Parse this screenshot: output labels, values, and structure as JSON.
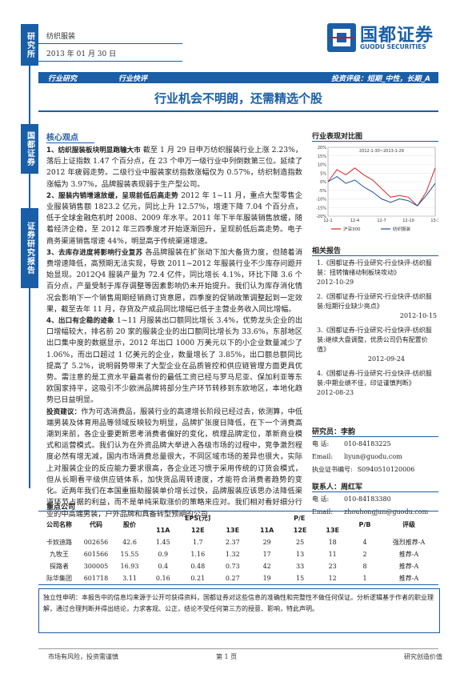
{
  "side": {
    "top_label": "研究所",
    "mid_label": "国都证券",
    "bottom_label": "证券研究报告"
  },
  "header": {
    "category": "纺织服装",
    "date": "2013 年 01 月 30 日",
    "logo_cn": "国都证券",
    "logo_en": "GUODU SECURITIES",
    "left_tag": "行业研究",
    "mid_tag": "行业快评",
    "rating": "投资评级：短期_中性，长期_A"
  },
  "title": "行业机会不明朗，还需精选个股",
  "core_view_title": "核心观点",
  "paragraphs": [
    {
      "bold": "1、纺织服装板块明显跑输大市",
      "text": "截至 1 月 29 日申万纺织服装行业上涨 2.23%，落后上证指数 1.47 个百分点，在 23 个申万一级行业中列倒数第三位。延续了 2012 年疲弱走势。二级行业中服装家纺指数涨幅仅为 0.57%，纺织制造指数涨幅为 3.97%，品牌服装表现弱于生产型公司。"
    },
    {
      "bold": "2、服装内销增速放缓，呈现前低后高走势",
      "text": "2012 年 1~11 月，重点大型零售企业服装销售额 1823.2 亿元，同比上升 12.57%，增速下降 7.04 个百分点，低于全球金融危机时 2008、2009 年水平。2011 年下半年服装销售放缓，随着经济企稳，至 2012 年三四季度才开始逐渐回升，呈现前低后高走势。电子商务渠道销售增速 44%，明显高于传统渠道增速。"
    },
    {
      "bold": "3、去库存进度将影响行业复苏",
      "text": "各品牌服装在扩张动下加大备货力度，但随着消费增速降低，高预期无法实现，导致 2011~2012 年服装行业不少库存问题开始显现。2012Q4 服装产量为 72.4 亿件，同比增长 4.1%，环比下降 3.6 个百分点，产量受制于库存调整等因素影响仍未开始提升。我们认为库存消化情况会影响下一个销售周期经销商订货意愿，四季度的促销政策调整起到一定效果，截至去年 11 月，存货及产成品同比增幅已低于主营业务收入同比增幅。"
    },
    {
      "bold": "4、出口有企稳的迹象",
      "text": "1~11 月服装出口额同比增长 3.4%，优势龙头企业的出口增幅较大，排名前 20 家的服装企业的出口额同比增长为 33.6%，东部地区出口集中度的数据显示，2012 年出口 1000 万美元以下的小企业数量减少了 1.06%，而出口超过 1 亿美元的企业，数量增长了 3.85%，出口额总额同比提高了 5.2%，说明弱势带来了大型企业在品质管控和供应链管理方面更具优势。需注意的是工资水平最高者份的最低工资已经与罗马尼亚、保加利亚等东欧国家持平，这吸引不少欧洲品牌将部分生产环节转移到东欧地区，本地化趋势已日益明显。"
    },
    {
      "bold": "投资建议：",
      "text": "作为可选消费品，服装行业的高速增长阶段已经过去，依测算，中低端男装及体育用品等领域反映较为明显，品牌扩张度日降低，在下一个消费高潮到来前，各企业要更新思考消费者偏好的变化，梳理品牌定位，革新商业模式和运营模式。我们认为在外资品牌大举进入各级市场的过程中，竞争激烈程度必然有增无减，国内市场消费总量很大，不同区域市场的差异也很大，实际上对服装企业的反应能力要求很高，各企业还习惯于采用传统的订货会模式，但从长期看平级供应链体系，加快货品周转速度，才能符合消费者趋势的变化。近两年我们在本国重振助服装单价增长过快，品牌服装应该思办法降低渠道环节占据的利益，而不是单纯采取涨价的策略来应对。我们相对看好细分行业的中高端男装，户外品牌和具备转型预期的公司。"
    }
  ],
  "chart": {
    "section_title": "行业表现对比图",
    "period": "2012-1-30~2013-1-29",
    "legend": [
      "沪深300",
      "纺织服装"
    ],
    "xticks": [
      "12-1",
      "12-4",
      "12-7",
      "12-10",
      "13-1"
    ],
    "yticks": [
      "20%",
      "15%",
      "10%",
      "5%",
      "0%",
      "-5%",
      "-10%",
      "-15%",
      "-20%"
    ]
  },
  "chart_data": {
    "type": "line",
    "x": [
      "12-1",
      "12-2",
      "12-3",
      "12-4",
      "12-5",
      "12-6",
      "12-7",
      "12-8",
      "12-9",
      "12-10",
      "12-11",
      "12-12",
      "13-1"
    ],
    "series": [
      {
        "name": "沪深300",
        "values": [
          0,
          7,
          4,
          8,
          4,
          1,
          -4,
          -9,
          -8,
          -9,
          -14,
          -6,
          8
        ]
      },
      {
        "name": "纺织服装",
        "values": [
          0,
          3,
          -1,
          1,
          -3,
          -6,
          -10,
          -12,
          -10,
          -11,
          -14,
          -8,
          -1
        ]
      }
    ],
    "ylim": [
      -20,
      20
    ],
    "xlabel": "",
    "ylabel": ""
  },
  "related": {
    "section_title": "相关报告",
    "items": [
      {
        "text": "1.《国都证券-行业研究-行业快评-纺织服装：扭转情绪动制板块攻动》",
        "date": "2012-10-29"
      },
      {
        "text": "2.《国都证券-行业研究-行业快评-纺织服装:短期行业缺少亮点》",
        "date": "2012-10-15"
      },
      {
        "text": "3.《国都证券-行业研究-行业快评-纺织服装:继续大盘调整，优质公司仍有配置价值》",
        "date": "2012-09-24"
      },
      {
        "text": "4.《国都证券-行业研究-行业快评-纺织服装:中期业绩不佳，印证谨慎判断》",
        "date": "2012-08-23"
      }
    ]
  },
  "analyst": {
    "title": "研究员：李韵",
    "phone_label": "电  话:",
    "phone": "010-84183225",
    "email_label": "Email:",
    "email": "liyun@guodu.com",
    "cert_label": "执业证书编号:",
    "cert": "S0940510120006"
  },
  "contact": {
    "title": "联系人：周红军",
    "phone_label": "电  话:",
    "phone": "010-84183380",
    "email_label": "Email:",
    "email": "zhouhongjun@guodu.com"
  },
  "table": {
    "title": "重点公司",
    "h_name": "公司名称",
    "h_code": "代码",
    "h_price": "股价",
    "h_eps": "EPS(元)",
    "h_pe": "P/E",
    "h_pb": "P/B",
    "h_rating": "评级",
    "years": [
      "11A",
      "12E",
      "13E",
      "11A",
      "12E",
      "13E"
    ],
    "rows": [
      {
        "name": "卡奴迪路",
        "code": "002656",
        "price": "42.6",
        "eps": [
          "1.45",
          "1.7",
          "2.37"
        ],
        "pe": [
          "29",
          "25",
          "18"
        ],
        "pb": "4",
        "rating": "强烈推荐-A"
      },
      {
        "name": "九牧王",
        "code": "601566",
        "price": "15.55",
        "eps": [
          "0.9",
          "1.16",
          "1.32"
        ],
        "pe": [
          "17",
          "13",
          "11"
        ],
        "pb": "2",
        "rating": "推荐-A"
      },
      {
        "name": "探路者",
        "code": "300005",
        "price": "16.93",
        "eps": [
          "0.4",
          "0.48",
          "0.73"
        ],
        "pe": [
          "42",
          "33",
          "23"
        ],
        "pb": "8",
        "rating": "推荐-A"
      },
      {
        "name": "际华集团",
        "code": "601718",
        "price": "3.11",
        "eps": [
          "0.16",
          "0.21",
          "0.27"
        ],
        "pe": [
          "19",
          "15",
          "12"
        ],
        "pb": "1",
        "rating": "推荐-A"
      }
    ]
  },
  "disclaimer": "独立性申明：本报告中的信息均来源于公开可获得资料，国都证券对这些信息的准确性和完整性不做任何保证。分析逻辑基于作者的职业理解，通过合理判断并得出结论，力求客观、公正，结论不受任何第三方的授意、影响，特此声明。",
  "footer": {
    "risk": "市场有风险，投资需谨慎",
    "page": "第 1 页",
    "right": "研究创造价值"
  }
}
